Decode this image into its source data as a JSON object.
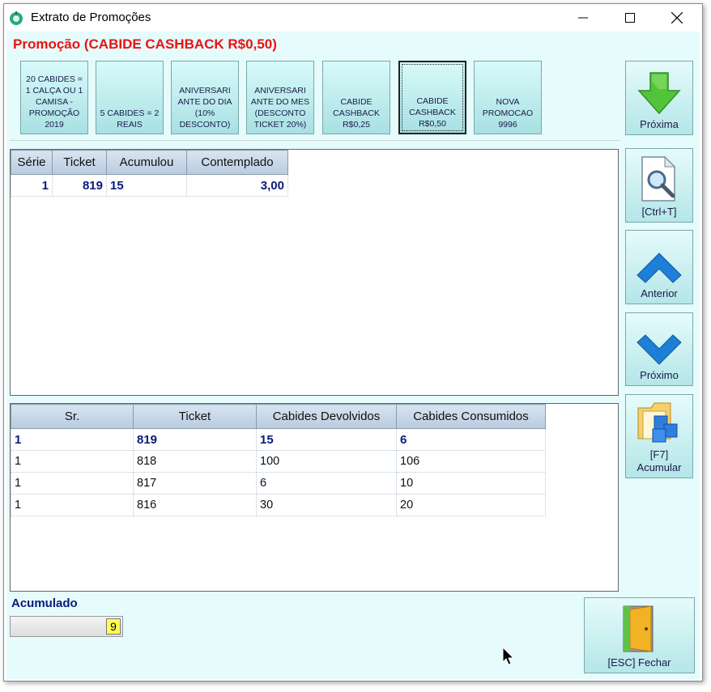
{
  "window": {
    "title": "Extrato de Promoções",
    "minimize_icon": "minimize-icon",
    "maximize_icon": "maximize-icon",
    "close_icon": "close-icon"
  },
  "promotion_title": "Promoção (CABIDE CASHBACK R$0,50)",
  "promotions": [
    {
      "label": "20 CABIDES = 1 CALÇA OU 1 CAMISA - PROMOÇÃO 2019"
    },
    {
      "label": "5 CABIDES = 2 REAIS"
    },
    {
      "label": "ANIVERSARI ANTE DO DIA (10% DESCONTO)"
    },
    {
      "label": "ANIVERSARI ANTE DO MES (DESCONTO TICKET 20%)"
    },
    {
      "label": "CABIDE CASHBACK R$0,25"
    },
    {
      "label": "CABIDE CASHBACK R$0,50",
      "selected": true
    },
    {
      "label": "NOVA PROMOCAO 9996"
    }
  ],
  "side_buttons": {
    "proxima": {
      "label": "Próxima",
      "icon": "arrow-down-green-icon"
    },
    "report": {
      "label": "[Ctrl+T]",
      "icon": "document-search-icon"
    },
    "anterior": {
      "label": "Anterior",
      "icon": "chevron-up-icon"
    },
    "proximo": {
      "label": "Próximo",
      "icon": "chevron-down-icon"
    },
    "acumular": {
      "label": "[F7] Acumular",
      "icon": "folder-cubes-icon"
    },
    "fechar": {
      "label": "[ESC] Fechar",
      "icon": "door-exit-icon"
    }
  },
  "summary_table": {
    "headers": [
      "Série",
      "Ticket",
      "Acumulou",
      "Contemplado"
    ],
    "rows": [
      [
        "1",
        "819",
        "15",
        "3,00"
      ]
    ]
  },
  "detail_table": {
    "headers": [
      "Sr.",
      "Ticket",
      "Cabides Devolvidos",
      "Cabides Consumidos"
    ],
    "rows": [
      [
        "1",
        "819",
        "15",
        "6"
      ],
      [
        "1",
        "818",
        "100",
        "106"
      ],
      [
        "1",
        "817",
        "6",
        "10"
      ],
      [
        "1",
        "816",
        "30",
        "20"
      ]
    ]
  },
  "acumulado": {
    "label": "Acumulado",
    "value": "9"
  },
  "colors": {
    "title_red": "#ee1111",
    "label_blue": "#0a1a7a",
    "background": "#e6fbfb"
  }
}
